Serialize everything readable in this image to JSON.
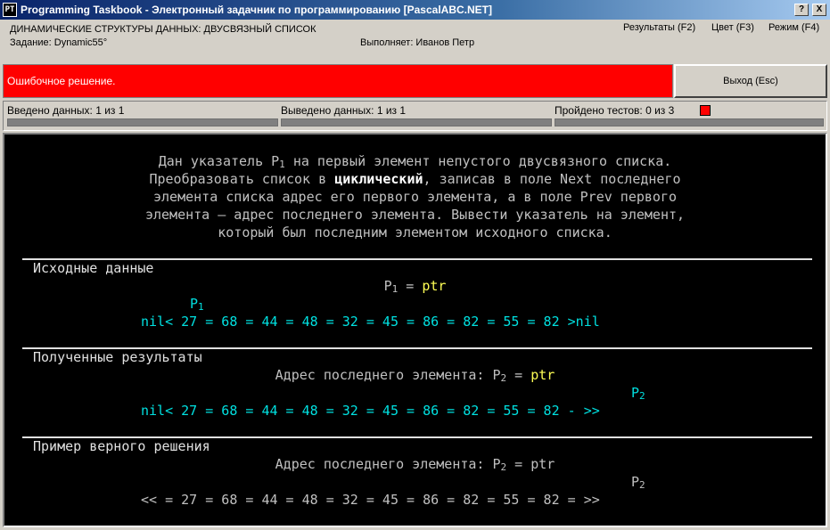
{
  "window": {
    "icon_label": "PT",
    "title": "Programming Taskbook - Электронный задачник по программированию [PascalABC.NET]",
    "help_button": "?",
    "close_button": "X"
  },
  "info": {
    "topic": "ДИНАМИЧЕСКИЕ СТРУКТУРЫ ДАННЫХ: ДВУСВЯЗНЫЙ СПИСОК",
    "task": "Задание: Dynamic55°",
    "author": "Выполняет: Иванов Петр",
    "menu_results": "Результаты (F2)",
    "menu_color": "Цвет (F3)",
    "menu_mode": "Режим (F4)"
  },
  "status": {
    "message": "Ошибочное решение.",
    "exit_label": "Выход (Esc)",
    "status_color": "#ff0000"
  },
  "progress": {
    "input_label": "Введено данных: 1 из 1",
    "output_label": "Выведено данных: 1 из 1",
    "tests_label": "Пройдено тестов: 0 из 3"
  },
  "task_text": {
    "line1_a": "Дан указатель P",
    "line1_sub": "1",
    "line1_b": " на первый элемент непустого двусвязного списка.",
    "line2_a": "Преобразовать список в ",
    "line2_bold": "циклический",
    "line2_b": ", записав в поле Next последнего",
    "line3": "элемента списка адрес его первого элемента, а в поле Prev первого",
    "line4": "элемента — адрес последнего элемента. Вывести указатель на элемент,",
    "line5": "который был последним элементом исходного списка."
  },
  "sections": {
    "input_header": "Исходные данные",
    "input_p_label": "P",
    "input_p_sub": "1",
    "input_eq": " = ",
    "input_p_value": "ptr",
    "input_pointer_label": "P",
    "input_pointer_sub": "1",
    "input_list": "nil< 27 = 68 = 44 = 48 = 32 = 45 = 86 = 82 = 55 = 82 >nil",
    "result_header": "Полученные результаты",
    "result_text": "Адрес последнего элемента: P",
    "result_sub": "2",
    "result_eq": " = ",
    "result_value": "ptr",
    "result_pointer_label": "P",
    "result_pointer_sub": "2",
    "result_list": "nil< 27 = 68 = 44 = 48 = 32 = 45 = 86 = 82 = 55 = 82 - >>",
    "example_header": "Пример верного решения",
    "example_text": "Адрес последнего элемента: P",
    "example_sub": "2",
    "example_eq": " = ",
    "example_value": "ptr",
    "example_pointer_label": "P",
    "example_pointer_sub": "2",
    "example_list": "<< = 27 = 68 = 44 = 48 = 32 = 45 = 86 = 82 = 55 = 82 = >>"
  },
  "colors": {
    "console_bg": "#000000",
    "text": "#c0c0c0",
    "data_cyan": "#00e0e0",
    "data_yellow": "#ffff55",
    "error_red": "#ff0000"
  }
}
